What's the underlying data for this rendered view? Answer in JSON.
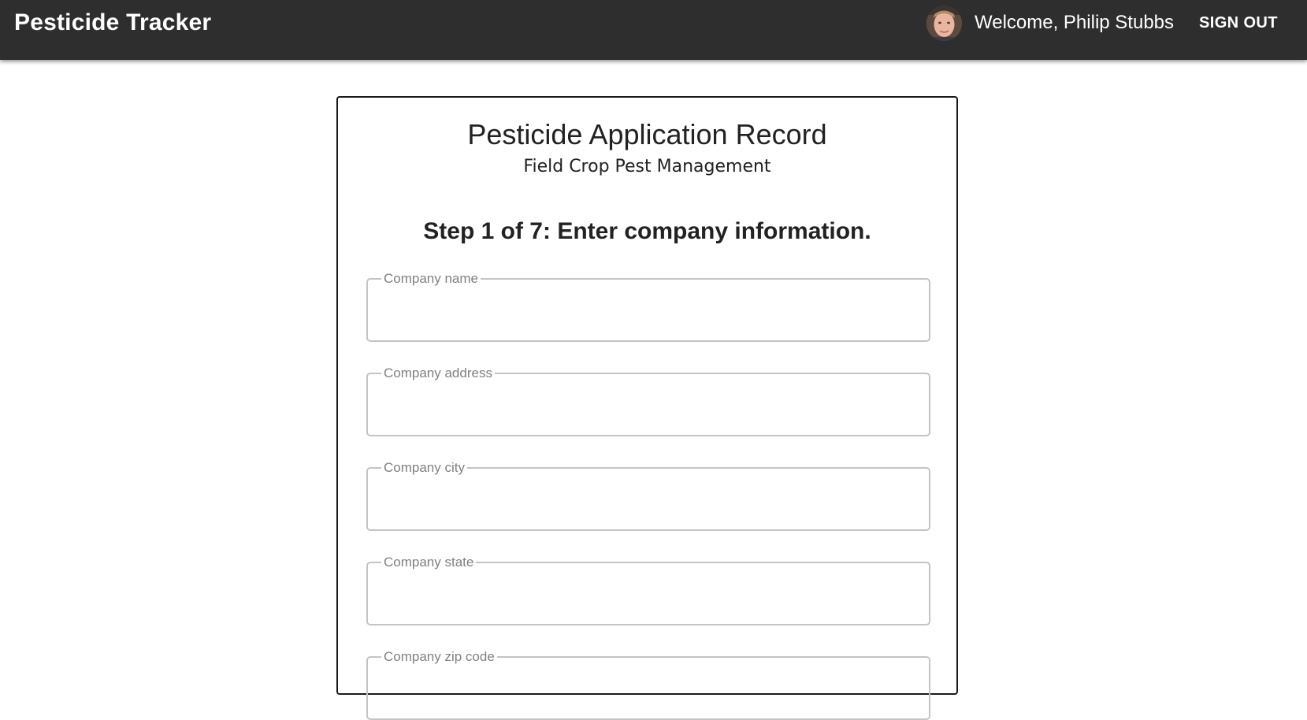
{
  "header": {
    "app_title": "Pesticide Tracker",
    "welcome_text": "Welcome, Philip Stubbs",
    "sign_out_label": "SIGN OUT",
    "avatar_icon": "user-avatar-photo"
  },
  "form": {
    "title": "Pesticide Application Record",
    "subtitle": "Field Crop Pest Management",
    "step_title": "Step 1 of 7: Enter company information.",
    "fields": [
      {
        "label": "Company name",
        "value": ""
      },
      {
        "label": "Company address",
        "value": ""
      },
      {
        "label": "Company city",
        "value": ""
      },
      {
        "label": "Company state",
        "value": ""
      },
      {
        "label": "Company zip code",
        "value": ""
      }
    ]
  },
  "colors": {
    "appbar_bg": "#2e2e2e",
    "field_border": "#c4c4c4",
    "label_gray": "#808080"
  }
}
